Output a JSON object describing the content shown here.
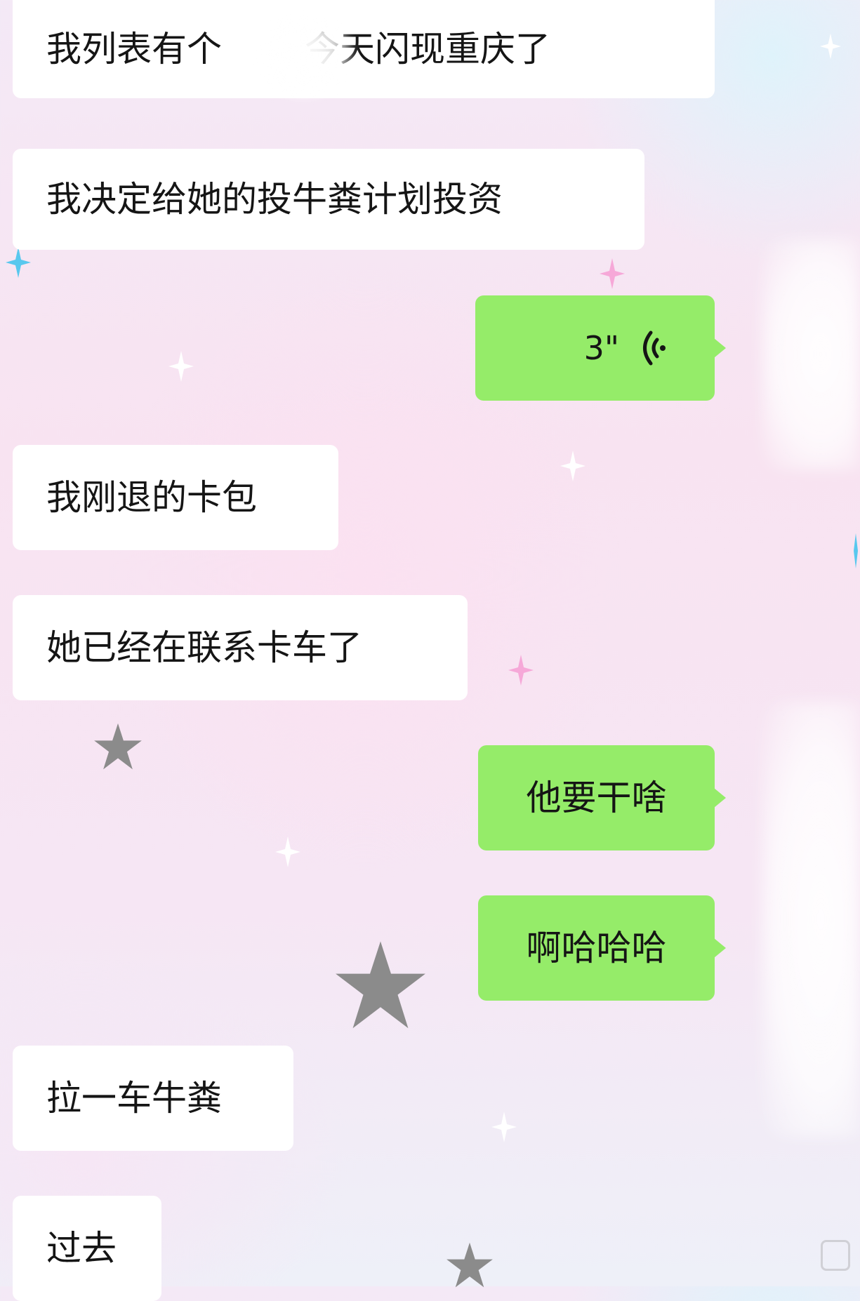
{
  "chat": {
    "messages": [
      {
        "side": "received",
        "type": "text",
        "text": "我列表有个",
        "text_after": "今天闪现重庆了",
        "redacted": true
      },
      {
        "side": "received",
        "type": "text",
        "text": "我决定给她的投牛粪计划投资"
      },
      {
        "side": "sent",
        "type": "voice",
        "duration": "3\""
      },
      {
        "side": "received",
        "type": "text",
        "text": "我刚退的卡包"
      },
      {
        "side": "received",
        "type": "text",
        "text": "她已经在联系卡车了"
      },
      {
        "side": "sent",
        "type": "text",
        "text": "他要干啥"
      },
      {
        "side": "sent",
        "type": "text",
        "text": "啊哈哈哈"
      },
      {
        "side": "received",
        "type": "text",
        "text": "拉一车牛粪"
      },
      {
        "side": "received",
        "type": "text",
        "text": "过去"
      }
    ]
  },
  "icons": {
    "voice": "voice-wave-icon",
    "sparkle": "sparkle-icon",
    "star": "star-icon"
  },
  "colors": {
    "sent_bubble": "#95ec69",
    "received_bubble": "#ffffff",
    "text": "#151515",
    "background": "#f8e3f1"
  }
}
